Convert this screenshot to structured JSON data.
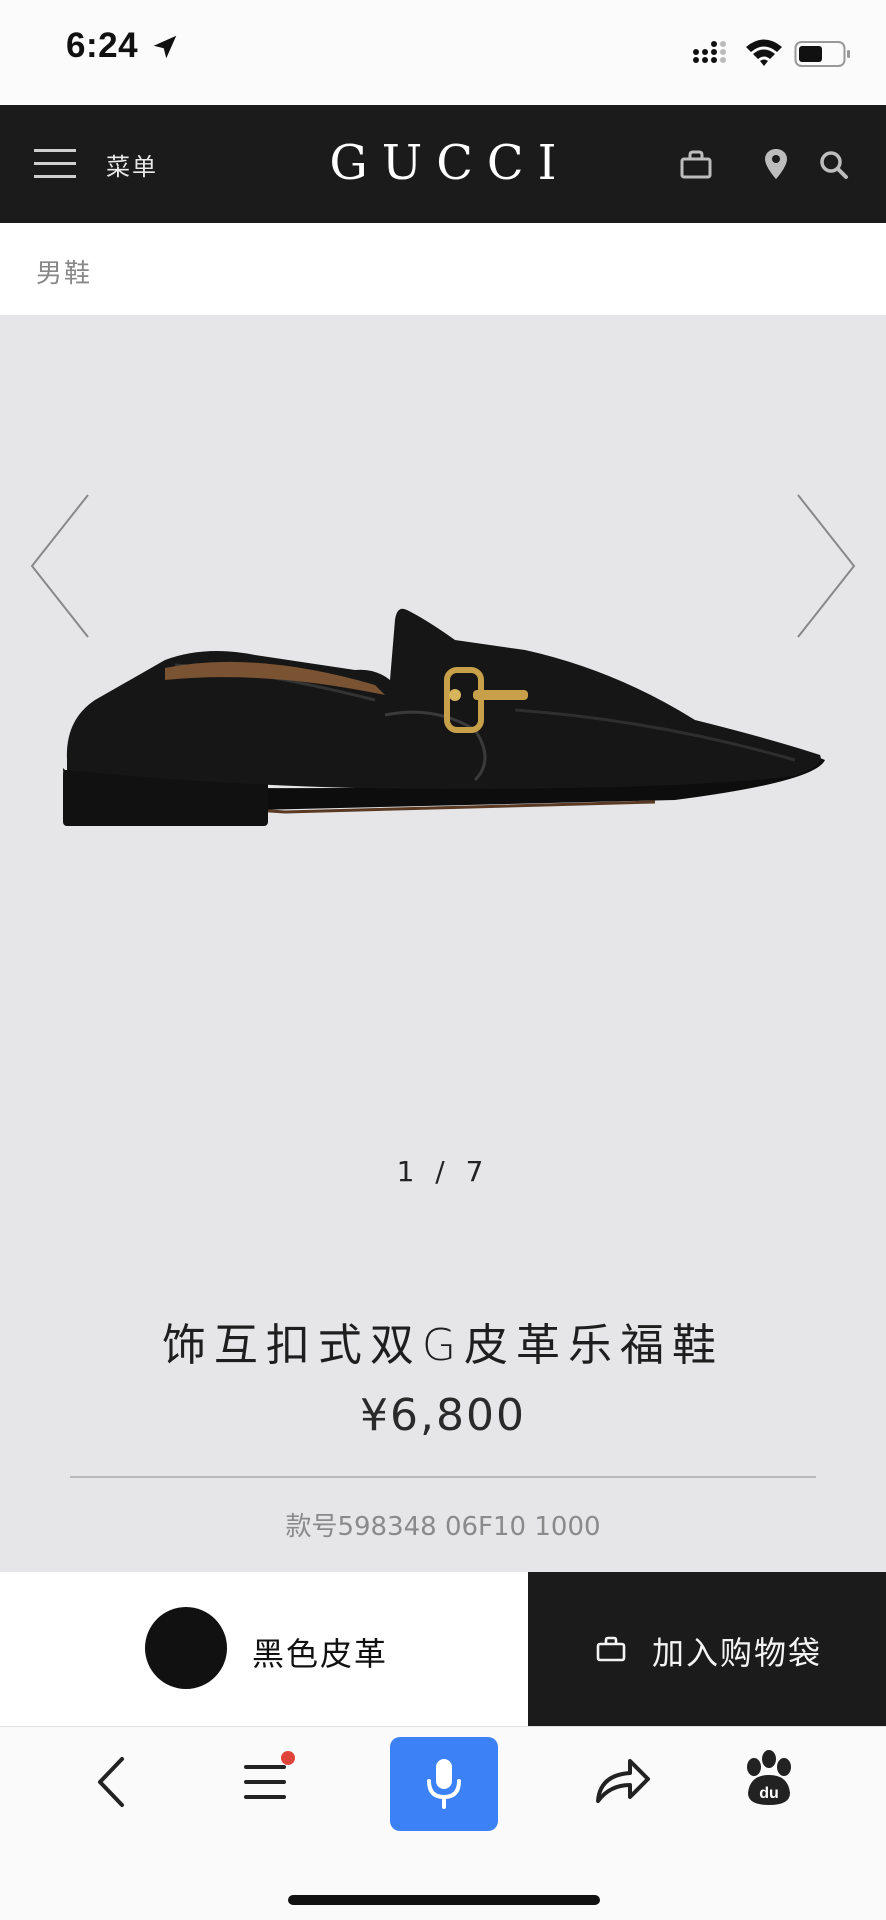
{
  "status_bar": {
    "time": "6:24"
  },
  "header": {
    "menu_label": "菜单",
    "brand": "GUCCI"
  },
  "breadcrumb": {
    "label": "男鞋"
  },
  "gallery": {
    "pager": "1 / 7"
  },
  "product": {
    "title": "饰互扣式双G皮革乐福鞋",
    "price": "¥6,800",
    "sku": "款号598348 06F10 1000"
  },
  "color_selector": {
    "label": "黑色皮革",
    "swatch_color": "#111111"
  },
  "cta": {
    "add_to_bag": "加入购物袋"
  },
  "colors": {
    "header_bg": "#1b1b1b",
    "page_bg": "#e6e6e8",
    "accent_blue": "#3c82f6",
    "notification_dot": "#e0453a"
  },
  "icons": [
    "location-arrow-icon",
    "signal-icon",
    "wifi-icon",
    "battery-icon",
    "hamburger-icon",
    "shopping-bag-icon",
    "location-pin-icon",
    "search-icon",
    "chevron-left-icon",
    "chevron-right-icon",
    "back-icon",
    "menu-icon",
    "microphone-icon",
    "share-icon",
    "baidu-paw-icon"
  ]
}
